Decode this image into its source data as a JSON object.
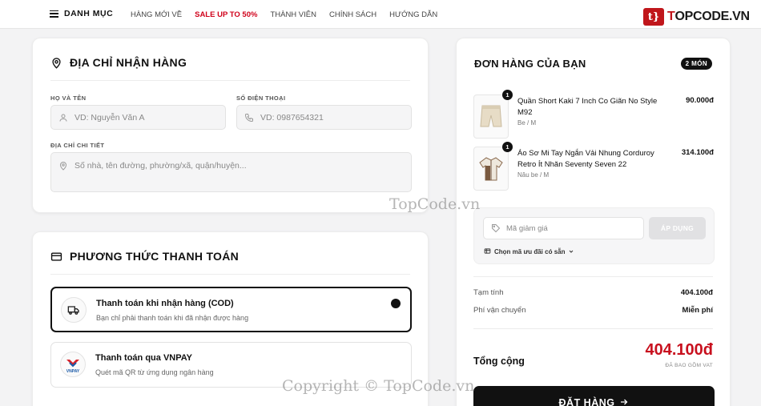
{
  "header": {
    "menu_label": "DANH MỤC",
    "nav": [
      "HÀNG MỚI VỀ",
      "SALE UP TO 50%",
      "THÀNH VIÊN",
      "CHÍNH SÁCH",
      "HƯỚNG DẪN"
    ],
    "logo_mark": "t}",
    "logo_text_prefix": "T",
    "logo_text_rest": "OPCODE.VN"
  },
  "address": {
    "title": "ĐỊA CHỈ NHẬN HÀNG",
    "name_label": "HỌ VÀ TÊN",
    "name_placeholder": "VD: Nguyễn Văn A",
    "phone_label": "SỐ ĐIỆN THOẠI",
    "phone_placeholder": "VD: 0987654321",
    "detail_label": "ĐỊA CHỈ CHI TIẾT",
    "detail_placeholder": "Số nhà, tên đường, phường/xã, quận/huyện..."
  },
  "payment": {
    "title": "PHƯƠNG THỨC THANH TOÁN",
    "options": [
      {
        "name": "Thanh toán khi nhận hàng (COD)",
        "desc": "Bạn chỉ phải thanh toán khi đã nhận được hàng",
        "selected": true
      },
      {
        "name": "Thanh toán qua VNPAY",
        "desc": "Quét mã QR từ ứng dụng ngân hàng",
        "selected": false,
        "icon_text": "VNPAY"
      }
    ]
  },
  "order": {
    "title": "ĐƠN HÀNG CỦA BẠN",
    "badge": "2 MÓN",
    "items": [
      {
        "qty": "1",
        "name": "Quần Short Kaki 7 Inch Co Giãn No Style M92",
        "variant": "Be / M",
        "price": "90.000đ"
      },
      {
        "qty": "1",
        "name": "Áo Sơ Mi Tay Ngắn Vải Nhung Corduroy Retro Ít Nhăn Seventy Seven 22",
        "variant": "Nâu be / M",
        "price": "314.100đ"
      }
    ],
    "coupon_placeholder": "Mã giảm giá",
    "apply_label": "ÁP DỤNG",
    "promo_link": "Chọn mã ưu đãi có sẵn",
    "subtotal_label": "Tạm tính",
    "subtotal_value": "404.100đ",
    "shipping_label": "Phí vận chuyển",
    "shipping_value": "Miễn phí",
    "total_label": "Tổng cộng",
    "total_value": "404.100đ",
    "vat_note": "ĐÃ BAO GỒM VAT",
    "order_button": "ĐẶT HÀNG"
  },
  "watermarks": {
    "center": "TopCode.vn",
    "bottom": "Copyright © TopCode.vn"
  },
  "colors": {
    "accent": "#c8101e",
    "primary": "#111111",
    "background": "#f3f3f4"
  }
}
